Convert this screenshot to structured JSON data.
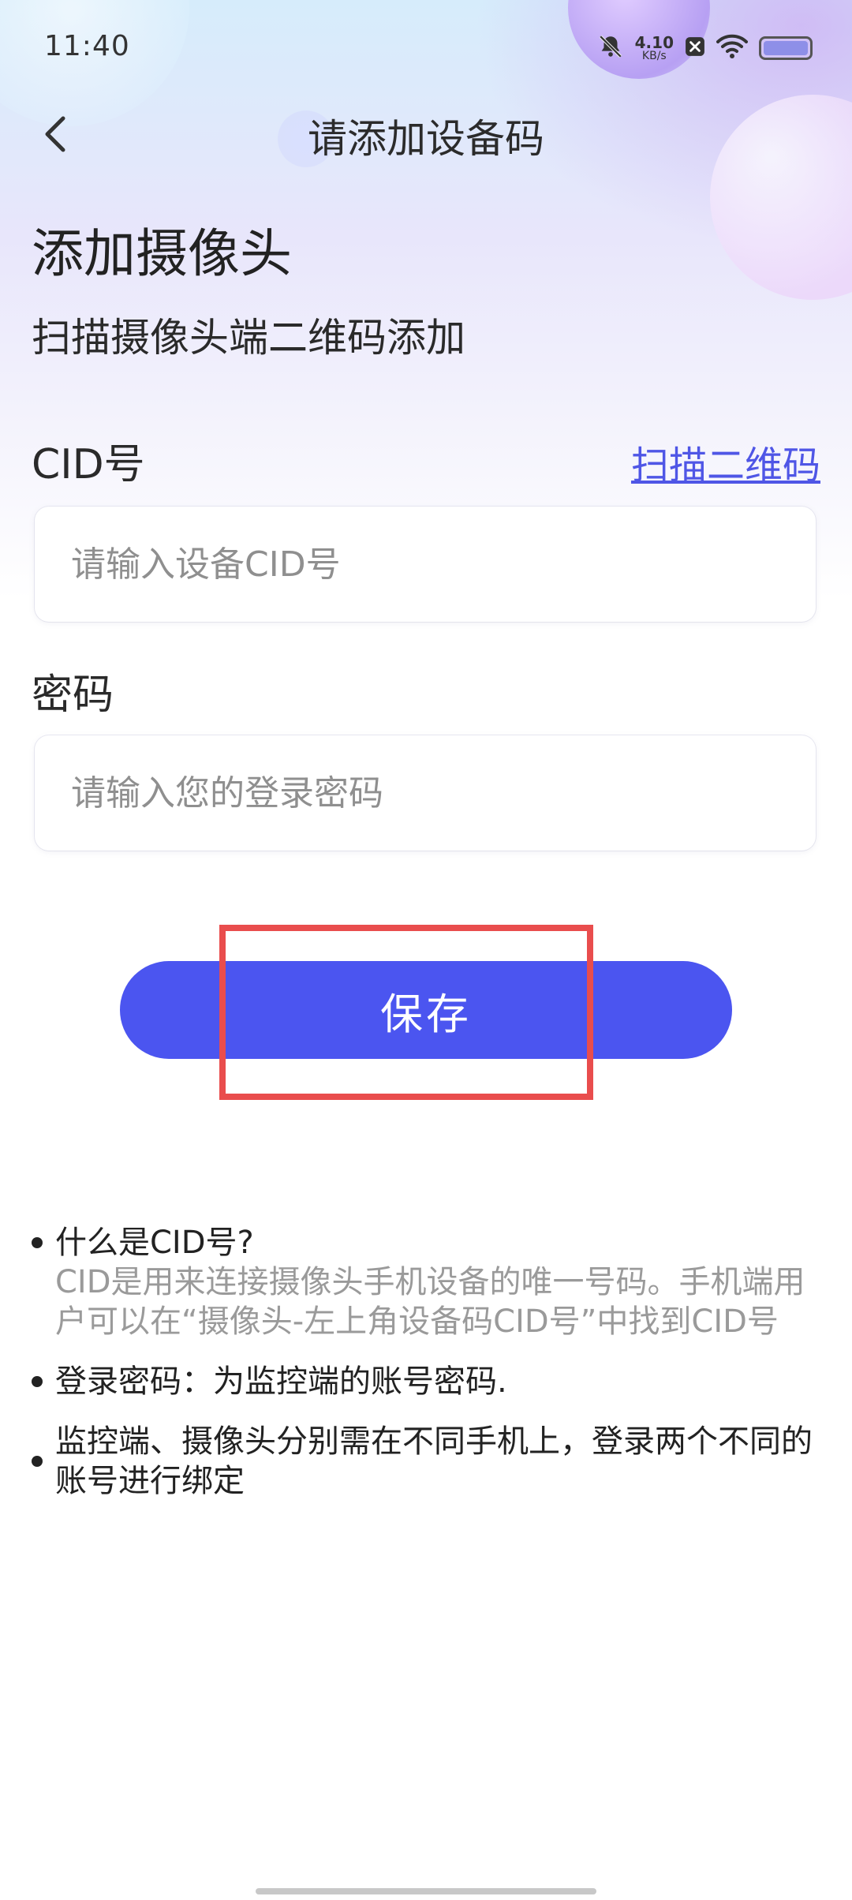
{
  "status_bar": {
    "time": "11:40",
    "net_speed_value": "4.10",
    "net_speed_unit": "KB/s",
    "icons": [
      "mute-bell-icon",
      "close-box-icon",
      "wifi-icon",
      "battery-icon"
    ],
    "battery_level": 1.0
  },
  "nav": {
    "back_icon": "chevron-left-icon",
    "title": "请添加设备码"
  },
  "page": {
    "heading": "添加摄像头",
    "subheading": "扫描摄像头端二维码添加"
  },
  "form": {
    "cid_label": "CID号",
    "scan_link": "扫描二维码",
    "cid_placeholder": "请输入设备CID号",
    "cid_value": "",
    "password_label": "密码",
    "password_placeholder": "请输入您的登录密码",
    "password_value": "",
    "save_label": "保存"
  },
  "help": [
    {
      "question": "什么是CID号?",
      "answer": "CID是用来连接摄像头手机设备的唯一号码。手机端用户可以在“摄像头-左上角设备码CID号”中找到CID号"
    },
    {
      "text": "登录密码：为监控端的账号密码."
    },
    {
      "text": "监控端、摄像头分别需在不同手机上，登录两个不同的账号进行绑定"
    }
  ],
  "colors": {
    "accent": "#4b55f0",
    "link": "#4f56e6",
    "highlight": "#e94d4d"
  }
}
